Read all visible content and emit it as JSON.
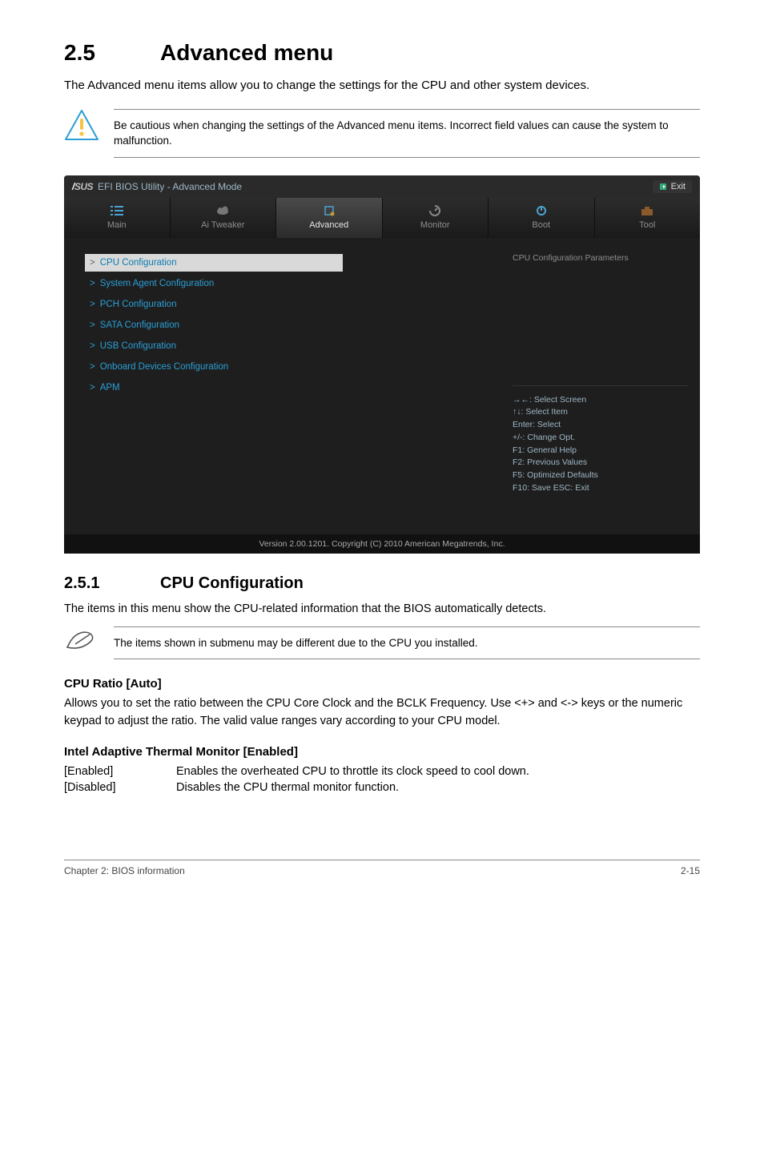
{
  "section": {
    "number": "2.5",
    "title": "Advanced menu"
  },
  "intro": "The Advanced menu items allow you to change the settings for the CPU and other system devices.",
  "warning": "Be cautious when changing the settings of the Advanced menu items. Incorrect field values can cause the system to malfunction.",
  "bios": {
    "titlebar": {
      "brand_slash": "/",
      "brand_rest": "SUS",
      "title": "EFI BIOS Utility - Advanced Mode",
      "exit": "Exit"
    },
    "tabs": [
      {
        "label": "Main"
      },
      {
        "label": "Ai Tweaker"
      },
      {
        "label": "Advanced",
        "active": true
      },
      {
        "label": "Monitor"
      },
      {
        "label": "Boot"
      },
      {
        "label": "Tool"
      }
    ],
    "menu": [
      {
        "label": "CPU Configuration",
        "selected": true
      },
      {
        "label": "System Agent Configuration"
      },
      {
        "label": "PCH Configuration"
      },
      {
        "label": "SATA Configuration"
      },
      {
        "label": "USB Configuration"
      },
      {
        "label": "Onboard Devices Configuration"
      },
      {
        "label": "APM"
      }
    ],
    "side": {
      "hint": "CPU Configuration Parameters",
      "keys": [
        "→←: Select Screen",
        "↑↓: Select Item",
        "Enter: Select",
        "+/-: Change Opt.",
        "F1: General Help",
        "F2: Previous Values",
        "F5: Optimized Defaults",
        "F10: Save   ESC: Exit"
      ]
    },
    "footer": "Version 2.00.1201.  Copyright (C) 2010 American Megatrends, Inc."
  },
  "subsection": {
    "number": "2.5.1",
    "title": "CPU Configuration"
  },
  "subsection_text": "The items in this menu show the CPU-related information that the BIOS automatically detects.",
  "note": "The items shown in submenu may be different due to the CPU you installed.",
  "options": [
    {
      "heading": "CPU Ratio [Auto]",
      "body": "Allows you to set the ratio between the CPU Core Clock and the BCLK Frequency. Use <+> and <-> keys or the numeric keypad to adjust the ratio. The valid value ranges vary according to your CPU model."
    },
    {
      "heading": "Intel Adaptive Thermal Monitor [Enabled]",
      "rows": [
        {
          "k": "[Enabled]",
          "v": "Enables the overheated CPU to throttle its clock speed to cool down."
        },
        {
          "k": "[Disabled]",
          "v": "Disables the CPU thermal monitor function."
        }
      ]
    }
  ],
  "footer": {
    "left": "Chapter 2: BIOS information",
    "right": "2-15"
  }
}
